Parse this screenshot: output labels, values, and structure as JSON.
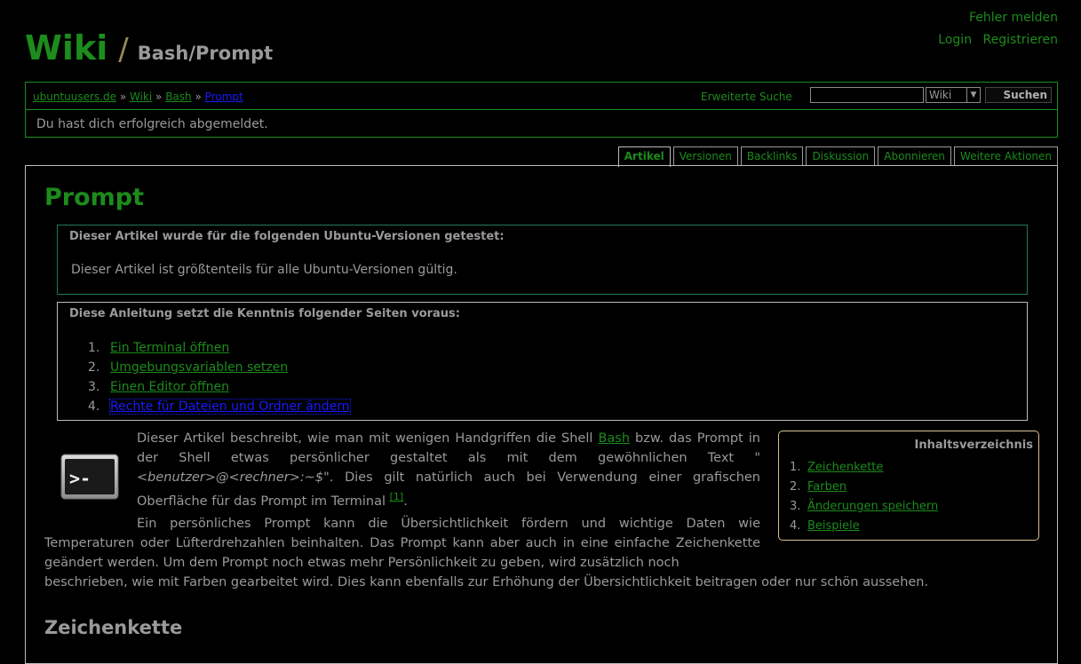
{
  "header": {
    "report_link": "Fehler melden",
    "login": "Login",
    "register": "Registrieren",
    "site": "Wiki",
    "separator": "/",
    "page_path": "Bash/Prompt"
  },
  "nav": {
    "breadcrumb": [
      "ubuntuusers.de",
      "Wiki",
      "Bash",
      "Prompt"
    ],
    "breadcrumb_sep": "»",
    "advanced_search": "Erweiterte Suche",
    "search_value": "",
    "search_scope": "Wiki",
    "search_button": "Suchen"
  },
  "flash_message": "Du hast dich erfolgreich abgemeldet.",
  "tabs": [
    "Artikel",
    "Versionen",
    "Backlinks",
    "Diskussion",
    "Abonnieren",
    "Weitere Aktionen"
  ],
  "article": {
    "title": "Prompt",
    "tested_box": {
      "heading": "Dieser Artikel wurde für die folgenden Ubuntu-Versionen getestet:",
      "body": "Dieser Artikel ist größtenteils für alle Ubuntu-Versionen gültig."
    },
    "prereq_box": {
      "heading": "Diese Anleitung setzt die Kenntnis folgender Seiten voraus:",
      "items": [
        {
          "num": "1.",
          "label": "Ein Terminal öffnen"
        },
        {
          "num": "2.",
          "label": "Umgebungsvariablen setzen"
        },
        {
          "num": "3.",
          "label": "Einen Editor öffnen"
        },
        {
          "num": "4.",
          "label": "Rechte für Dateien und Ordner ändern"
        }
      ]
    },
    "intro": {
      "t1": "Dieser Artikel beschreibt, wie man mit wenigen Handgriffen die Shell ",
      "bash_link": "Bash",
      "t2": " bzw. das Prompt in der Shell etwas persönlicher gestaltet als mit dem gewöhnlichen Text \"",
      "code": "<benutzer>@<rechner>:~$",
      "t3": "\". Dies gilt natürlich auch bei Verwendung einer grafischen Oberfläche für das Prompt im Terminal ",
      "footnote": "[1]",
      "t4": "."
    },
    "para2a": "Ein persönliches Prompt kann die Übersichtlichkeit fördern und wichtige Daten wie Temperaturen oder Lüfterdrehzahlen beinhalten. Das Prompt kann aber auch in eine einfache Zeichenkette geändert werden. Um dem Prompt noch etwas mehr Persönlichkeit zu geben, wird zusätzlich noch",
    "para2b": "beschrieben, wie mit Farben gearbeitet wird. Dies kann ebenfalls zur Erhöhung der Übersichtlichkeit beitragen oder nur schön aussehen.",
    "toc": {
      "heading": "Inhaltsverzeichnis",
      "items": [
        {
          "num": "1.",
          "label": "Zeichenkette"
        },
        {
          "num": "2.",
          "label": "Farben"
        },
        {
          "num": "3.",
          "label": "Änderungen speichern"
        },
        {
          "num": "4.",
          "label": "Beispiele"
        }
      ]
    },
    "section_heading": "Zeichenkette"
  },
  "colors": {
    "background": "#000000",
    "link": "#1c8c1c",
    "text": "#9a9a9a",
    "focused_link": "#1a1aff"
  }
}
